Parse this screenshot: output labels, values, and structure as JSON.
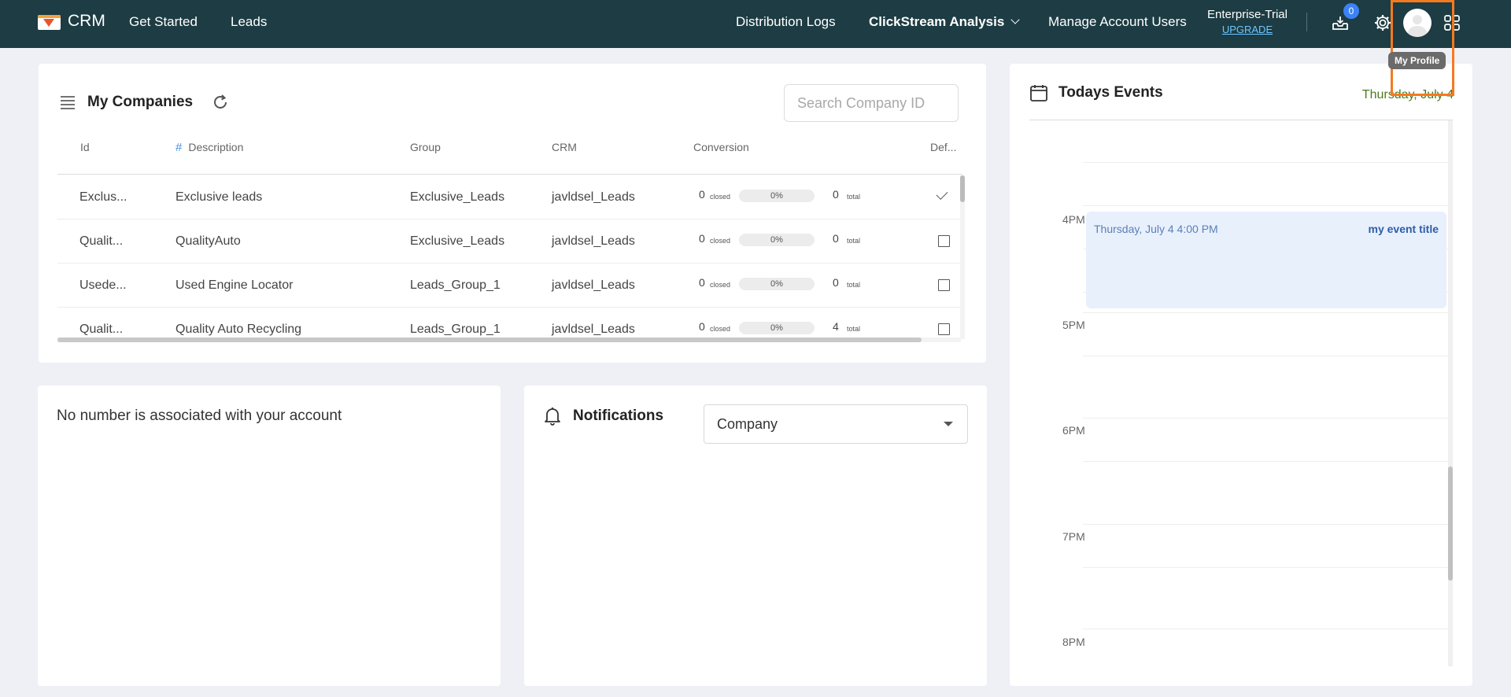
{
  "header": {
    "brand": "CRM",
    "nav": {
      "get_started": "Get Started",
      "leads": "Leads",
      "distribution_logs": "Distribution Logs",
      "clickstream": "ClickStream Analysis",
      "manage_users": "Manage Account Users"
    },
    "plan": "Enterprise-Trial",
    "upgrade": "UPGRADE",
    "inbox_count": "0",
    "profile_tooltip": "My Profile"
  },
  "companies": {
    "title": "My Companies",
    "search_placeholder": "Search Company ID",
    "columns": {
      "id": "Id",
      "description": "Description",
      "group": "Group",
      "crm": "CRM",
      "conversion": "Conversion",
      "default": "Def..."
    },
    "conv_labels": {
      "closed": "closed",
      "total": "total"
    },
    "rows": [
      {
        "id": "Exclus...",
        "description": "Exclusive leads",
        "group": "Exclusive_Leads",
        "crm": "javldsel_Leads",
        "closed": "0",
        "percent": "0%",
        "total": "0",
        "default": true
      },
      {
        "id": "Qualit...",
        "description": "QualityAuto",
        "group": "Exclusive_Leads",
        "crm": "javldsel_Leads",
        "closed": "0",
        "percent": "0%",
        "total": "0",
        "default": false
      },
      {
        "id": "Usede...",
        "description": "Used Engine Locator",
        "group": "Leads_Group_1",
        "crm": "javldsel_Leads",
        "closed": "0",
        "percent": "0%",
        "total": "0",
        "default": false
      },
      {
        "id": "Qualit...",
        "description": "Quality Auto Recycling",
        "group": "Leads_Group_1",
        "crm": "javldsel_Leads",
        "closed": "0",
        "percent": "0%",
        "total": "4",
        "default": false
      }
    ]
  },
  "phone": {
    "message": "No number is associated with your account"
  },
  "notifications": {
    "title": "Notifications",
    "filter_value": "Company"
  },
  "events": {
    "title": "Todays Events",
    "date": "Thursday, July 4",
    "hours": [
      "4PM",
      "5PM",
      "6PM",
      "7PM",
      "8PM"
    ],
    "event": {
      "time": "Thursday, July 4 4:00 PM",
      "title": "my event title"
    }
  },
  "colors": {
    "topbar": "#1d3c43",
    "highlight": "#f47a20",
    "badge": "#3b82f6",
    "event_bg": "#e8f0fc",
    "date_text": "#4c7a20"
  }
}
